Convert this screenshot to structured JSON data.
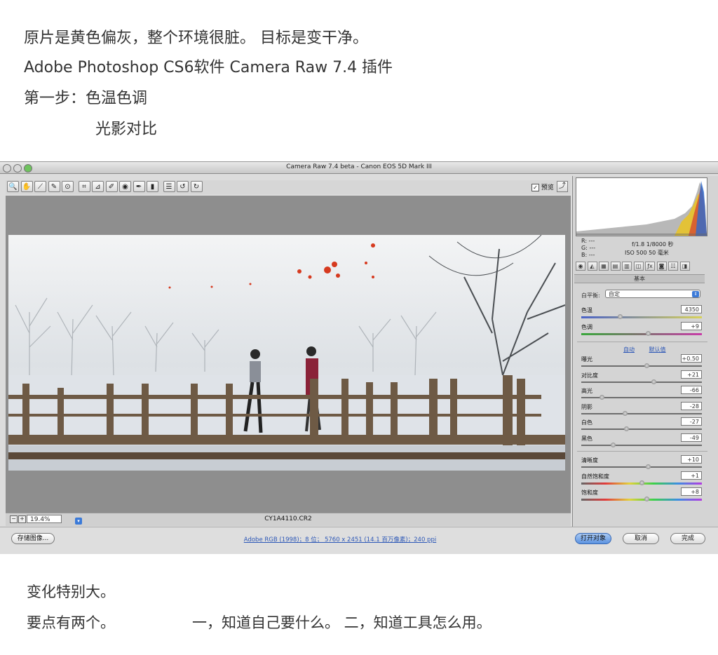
{
  "intro": {
    "line1": "原片是黄色偏灰，整个环境很脏。 目标是变干净。",
    "line2": "Adobe Photoshop CS6软件 Camera Raw 7.4 插件",
    "line3": "第一步：色温色调",
    "line4": "光影对比"
  },
  "outro": {
    "line1": "变化特别大。",
    "line2a": "要点有两个。",
    "line2b": "一，知道自己要什么。 二，知道工具怎么用。"
  },
  "window": {
    "title": "Camera Raw 7.4 beta -  Canon EOS 5D Mark III"
  },
  "toolbar": {
    "tools": [
      {
        "icon": "zoom-icon",
        "glyph": "🔍"
      },
      {
        "icon": "hand-icon",
        "glyph": "✋"
      },
      {
        "icon": "white-balance-icon",
        "glyph": "⟋"
      },
      {
        "icon": "color-sampler-icon",
        "glyph": "✎"
      },
      {
        "icon": "target-adjust-icon",
        "glyph": "⊙"
      },
      {
        "icon": "crop-icon",
        "glyph": "⌗"
      },
      {
        "icon": "straighten-icon",
        "glyph": "⊿"
      },
      {
        "icon": "spot-removal-icon",
        "glyph": "✐"
      },
      {
        "icon": "red-eye-icon",
        "glyph": "◉"
      },
      {
        "icon": "adjustment-brush-icon",
        "glyph": "✒"
      },
      {
        "icon": "graduated-filter-icon",
        "glyph": "▮"
      },
      {
        "icon": "preferences-icon",
        "glyph": "☰"
      },
      {
        "icon": "rotate-left-icon",
        "glyph": "↺"
      },
      {
        "icon": "rotate-right-icon",
        "glyph": "↻"
      }
    ],
    "preview_label": "预览",
    "preview_checked": "✓"
  },
  "canvas": {
    "zoom": "19.4%",
    "filename": "CY1A4110.CR2"
  },
  "info": {
    "r": "R:  ---",
    "g": "G:  ---",
    "b": "B:  ---",
    "aperture_shutter": "f/1.8   1/8000 秒",
    "iso_focal": "ISO 500   50 毫米"
  },
  "panel": {
    "tabs": [
      "◉",
      "◭",
      "▦",
      "▤",
      "▥",
      "◫",
      "ƒx",
      "◙",
      "☷",
      "◨"
    ],
    "tab_icons": [
      "basic-tab-icon",
      "tone-curve-tab-icon",
      "detail-tab-icon",
      "hsl-tab-icon",
      "split-toning-tab-icon",
      "lens-tab-icon",
      "effects-tab-icon",
      "camera-calibration-tab-icon",
      "presets-tab-icon",
      "snapshots-tab-icon"
    ],
    "section_title": "基本",
    "wb_label": "白平衡:",
    "wb_value": "自定",
    "auto_label": "自动",
    "default_label": "默认值",
    "sliders_top": [
      {
        "name": "temp",
        "label": "色温",
        "value": "4350",
        "pos": 0.32,
        "kind": "temp"
      },
      {
        "name": "tint",
        "label": "色调",
        "value": "+9",
        "pos": 0.55,
        "kind": "tint"
      }
    ],
    "sliders_tone": [
      {
        "name": "exposure",
        "label": "曝光",
        "value": "+0.50",
        "pos": 0.54
      },
      {
        "name": "contrast",
        "label": "对比度",
        "value": "+21",
        "pos": 0.6
      },
      {
        "name": "highlights",
        "label": "高光",
        "value": "-66",
        "pos": 0.17
      },
      {
        "name": "shadows",
        "label": "阴影",
        "value": "-28",
        "pos": 0.36
      },
      {
        "name": "whites",
        "label": "白色",
        "value": "-27",
        "pos": 0.37
      },
      {
        "name": "blacks",
        "label": "黑色",
        "value": "-49",
        "pos": 0.26
      }
    ],
    "sliders_presence": [
      {
        "name": "clarity",
        "label": "清晰度",
        "value": "+10",
        "pos": 0.55
      },
      {
        "name": "vibrance",
        "label": "自然饱和度",
        "value": "+1",
        "pos": 0.5,
        "kind": "vib"
      },
      {
        "name": "saturation",
        "label": "饱和度",
        "value": "+8",
        "pos": 0.54,
        "kind": "sat"
      }
    ]
  },
  "footer": {
    "save_label": "存储图像...",
    "workflow": "Adobe RGB (1998)；8 位；  5760 x 2451 (14.1 百万像素)；240 ppi",
    "open_label": "打开对象",
    "cancel_label": "取消",
    "done_label": "完成"
  }
}
